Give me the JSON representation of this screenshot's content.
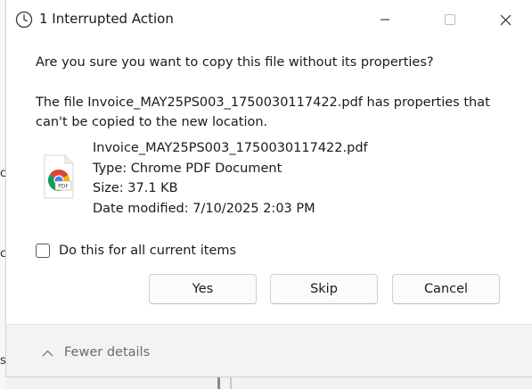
{
  "window": {
    "title": "1 Interrupted Action"
  },
  "dialog": {
    "message": "Are you sure you want to copy this file without its properties?",
    "explanation": "The file Invoice_MAY25PS003_1750030117422.pdf has properties that can't be copied to the new location."
  },
  "file": {
    "icon": "chrome-pdf-file-icon",
    "name": "Invoice_MAY25PS003_1750030117422.pdf",
    "type": "Type: Chrome PDF Document",
    "size": "Size: 37.1 KB",
    "date_modified": "Date modified: 7/10/2025 2:03 PM",
    "icon_badge": "PDF"
  },
  "checkbox": {
    "label": "Do this for all current items",
    "checked": false
  },
  "buttons": {
    "yes": "Yes",
    "skip": "Skip",
    "cancel": "Cancel"
  },
  "footer": {
    "toggle_label": "Fewer details"
  },
  "colors": {
    "chrome_red": "#db4437",
    "chrome_yellow": "#f4b400",
    "chrome_green": "#0f9d58",
    "chrome_blue": "#4285f4"
  }
}
